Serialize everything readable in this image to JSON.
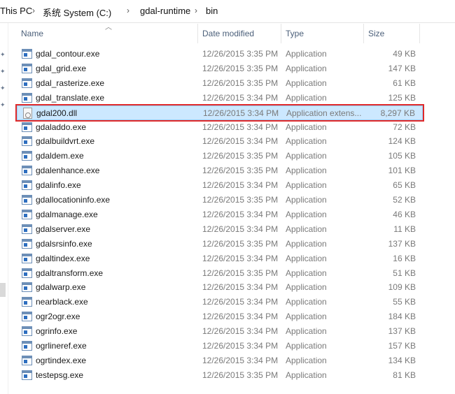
{
  "breadcrumb": {
    "items": [
      "This PC",
      "系统 System (C:)",
      "gdal-runtime",
      "bin"
    ]
  },
  "columns": {
    "name": "Name",
    "date": "Date modified",
    "type": "Type",
    "size": "Size"
  },
  "selected_index": 4,
  "files": [
    {
      "name": "gdal_contour.exe",
      "date": "12/26/2015 3:35 PM",
      "type": "Application",
      "size": "49 KB"
    },
    {
      "name": "gdal_grid.exe",
      "date": "12/26/2015 3:35 PM",
      "type": "Application",
      "size": "147 KB"
    },
    {
      "name": "gdal_rasterize.exe",
      "date": "12/26/2015 3:35 PM",
      "type": "Application",
      "size": "61 KB"
    },
    {
      "name": "gdal_translate.exe",
      "date": "12/26/2015 3:34 PM",
      "type": "Application",
      "size": "125 KB"
    },
    {
      "name": "gdal200.dll",
      "date": "12/26/2015 3:34 PM",
      "type": "Application extens...",
      "size": "8,297 KB"
    },
    {
      "name": "gdaladdo.exe",
      "date": "12/26/2015 3:34 PM",
      "type": "Application",
      "size": "72 KB"
    },
    {
      "name": "gdalbuildvrt.exe",
      "date": "12/26/2015 3:34 PM",
      "type": "Application",
      "size": "124 KB"
    },
    {
      "name": "gdaldem.exe",
      "date": "12/26/2015 3:35 PM",
      "type": "Application",
      "size": "105 KB"
    },
    {
      "name": "gdalenhance.exe",
      "date": "12/26/2015 3:35 PM",
      "type": "Application",
      "size": "101 KB"
    },
    {
      "name": "gdalinfo.exe",
      "date": "12/26/2015 3:34 PM",
      "type": "Application",
      "size": "65 KB"
    },
    {
      "name": "gdallocationinfo.exe",
      "date": "12/26/2015 3:35 PM",
      "type": "Application",
      "size": "52 KB"
    },
    {
      "name": "gdalmanage.exe",
      "date": "12/26/2015 3:34 PM",
      "type": "Application",
      "size": "46 KB"
    },
    {
      "name": "gdalserver.exe",
      "date": "12/26/2015 3:34 PM",
      "type": "Application",
      "size": "11 KB"
    },
    {
      "name": "gdalsrsinfo.exe",
      "date": "12/26/2015 3:35 PM",
      "type": "Application",
      "size": "137 KB"
    },
    {
      "name": "gdaltindex.exe",
      "date": "12/26/2015 3:34 PM",
      "type": "Application",
      "size": "16 KB"
    },
    {
      "name": "gdaltransform.exe",
      "date": "12/26/2015 3:35 PM",
      "type": "Application",
      "size": "51 KB"
    },
    {
      "name": "gdalwarp.exe",
      "date": "12/26/2015 3:34 PM",
      "type": "Application",
      "size": "109 KB"
    },
    {
      "name": "nearblack.exe",
      "date": "12/26/2015 3:34 PM",
      "type": "Application",
      "size": "55 KB"
    },
    {
      "name": "ogr2ogr.exe",
      "date": "12/26/2015 3:34 PM",
      "type": "Application",
      "size": "184 KB"
    },
    {
      "name": "ogrinfo.exe",
      "date": "12/26/2015 3:34 PM",
      "type": "Application",
      "size": "137 KB"
    },
    {
      "name": "ogrlineref.exe",
      "date": "12/26/2015 3:34 PM",
      "type": "Application",
      "size": "157 KB"
    },
    {
      "name": "ogrtindex.exe",
      "date": "12/26/2015 3:34 PM",
      "type": "Application",
      "size": "134 KB"
    },
    {
      "name": "testepsg.exe",
      "date": "12/26/2015 3:35 PM",
      "type": "Application",
      "size": "81 KB"
    }
  ]
}
